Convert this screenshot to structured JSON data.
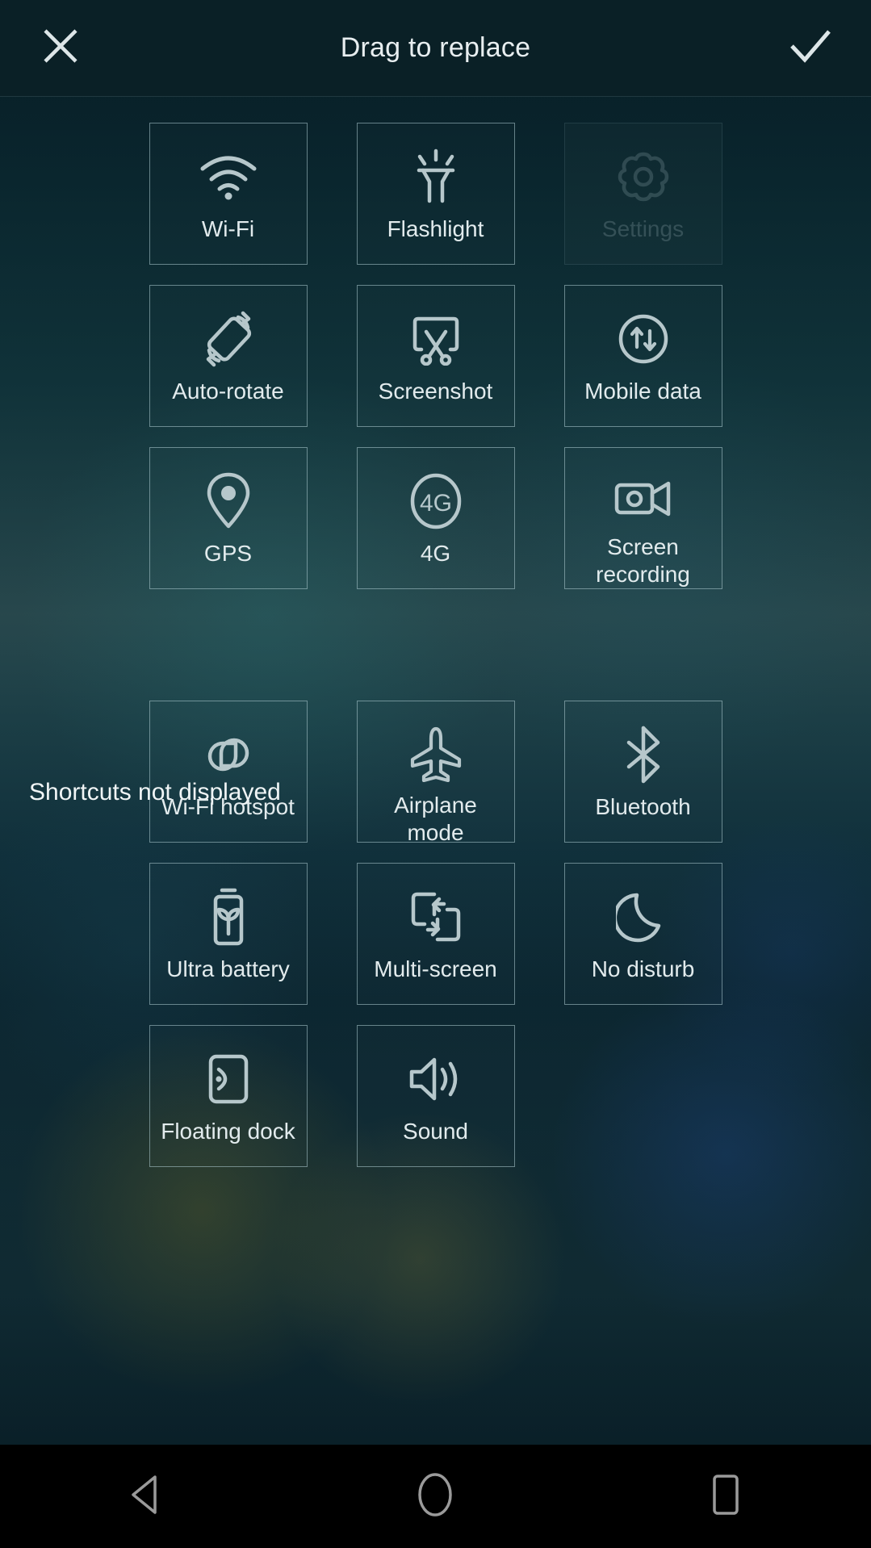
{
  "header": {
    "title": "Drag to replace",
    "close_icon": "close-icon",
    "confirm_icon": "check-icon"
  },
  "displayed_section": {
    "tiles": [
      {
        "label": "Wi-Fi",
        "icon": "wifi-icon",
        "state": "enabled"
      },
      {
        "label": "Flashlight",
        "icon": "flashlight-icon",
        "state": "enabled"
      },
      {
        "label": "Settings",
        "icon": "gear-icon",
        "state": "dimmed"
      },
      {
        "label": "Auto-rotate",
        "icon": "auto-rotate-icon",
        "state": "enabled"
      },
      {
        "label": "Screenshot",
        "icon": "scissors-icon",
        "state": "enabled"
      },
      {
        "label": "Mobile data",
        "icon": "mobile-data-icon",
        "state": "enabled"
      },
      {
        "label": "GPS",
        "icon": "location-pin-icon",
        "state": "enabled"
      },
      {
        "label": "4G",
        "icon": "four-g-icon",
        "state": "enabled"
      },
      {
        "label": "Screen\nrecording",
        "icon": "screen-recording-icon",
        "state": "enabled"
      }
    ]
  },
  "hidden_section": {
    "title": "Shortcuts not displayed",
    "tiles": [
      {
        "label": "Wi-Fi hotspot",
        "icon": "hotspot-icon",
        "state": "enabled"
      },
      {
        "label": "Airplane\nmode",
        "icon": "airplane-icon",
        "state": "enabled"
      },
      {
        "label": "Bluetooth",
        "icon": "bluetooth-icon",
        "state": "enabled"
      },
      {
        "label": "Ultra battery",
        "icon": "battery-leaf-icon",
        "state": "enabled"
      },
      {
        "label": "Multi-screen",
        "icon": "multi-screen-icon",
        "state": "enabled"
      },
      {
        "label": "No disturb",
        "icon": "moon-icon",
        "state": "enabled"
      },
      {
        "label": "Floating dock",
        "icon": "floating-dock-icon",
        "state": "enabled"
      },
      {
        "label": "Sound",
        "icon": "speaker-icon",
        "state": "enabled"
      },
      {
        "label": "",
        "icon": "",
        "state": "empty"
      }
    ]
  },
  "navbar": {
    "back_icon": "back-triangle-icon",
    "home_icon": "home-circle-icon",
    "recents_icon": "recents-square-icon"
  },
  "colors": {
    "header_bg": "#0a2026",
    "text_primary": "#e8eef0",
    "icon_stroke": "#b6c7cb",
    "tile_border": "rgba(176,205,212,0.55)",
    "navbar_bg": "#000000"
  }
}
